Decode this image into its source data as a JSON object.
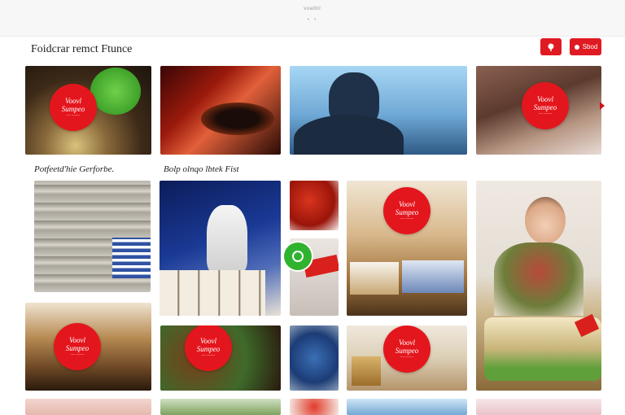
{
  "header": {
    "title": "voalbtr",
    "dots": "• •"
  },
  "page": {
    "heading": "Foidcrar remct Ftunce"
  },
  "buttons": {
    "save_label": "Sbod"
  },
  "section": {
    "left_label": "Potfeetd'hie Gerforbe.",
    "right_label": "Bolp olnqo lbtek Fist"
  },
  "badge": {
    "line1": "Voovl",
    "line2": "Sumpeo",
    "line3": "—  ——"
  },
  "colors": {
    "accent": "#e01a22",
    "badge": "#e4161d",
    "green": "#2fb32f"
  }
}
